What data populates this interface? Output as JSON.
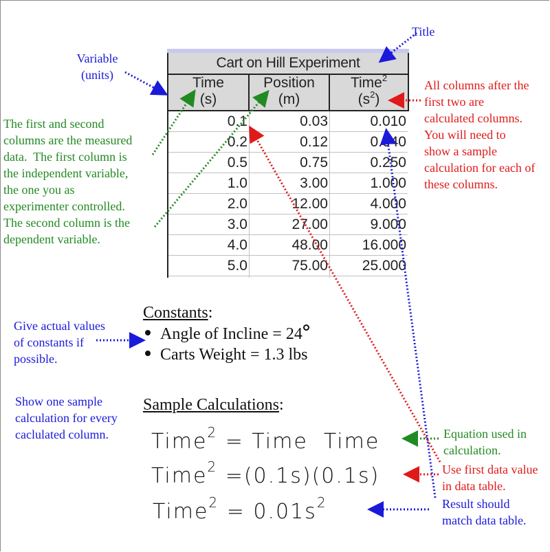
{
  "table": {
    "title": "Cart on Hill Experiment",
    "columns": [
      {
        "name": "Time",
        "unit": "(s)"
      },
      {
        "name": "Position",
        "unit": "(m)"
      },
      {
        "name": "Time",
        "name_sup": "2",
        "unit_base": "(s",
        "unit_sup": "2",
        "unit_close": ")"
      }
    ],
    "rows": [
      [
        "0.1",
        "0.03",
        "0.010"
      ],
      [
        "0.2",
        "0.12",
        "0.040"
      ],
      [
        "0.5",
        "0.75",
        "0.250"
      ],
      [
        "1.0",
        "3.00",
        "1.000"
      ],
      [
        "2.0",
        "12.00",
        "4.000"
      ],
      [
        "3.0",
        "27.00",
        "9.000"
      ],
      [
        "4.0",
        "48.00",
        "16.000"
      ],
      [
        "5.0",
        "75.00",
        "25.000"
      ]
    ]
  },
  "annotations": {
    "title_label": "Title",
    "variable_units": [
      "Variable",
      "(units)"
    ],
    "measured_columns": [
      "The first and second",
      "columns are the measured",
      "data.  The first column is",
      "the independent variable,",
      "the one you as",
      "experimenter controlled.",
      "The second column is the",
      "dependent variable."
    ],
    "calculated_columns": [
      "All columns after the",
      "first two are",
      "calculated columns.",
      "You will need to",
      "show a sample",
      "calculation for each of",
      "these columns."
    ],
    "constants_note": [
      "Give actual values",
      "of constants if",
      "possible."
    ],
    "sample_note": [
      "Show one sample",
      "calculation for every",
      "caclulated column."
    ],
    "equation_note": [
      "Equation used in",
      "calculation."
    ],
    "first_value_note": [
      "Use first data value",
      "in data table."
    ],
    "result_note": [
      "Result should",
      "match data table."
    ]
  },
  "constants": {
    "heading": "Constants",
    "heading_suffix": ":",
    "items": [
      {
        "text": "Angle of Incline = 24"
      },
      {
        "text": "Carts Weight = 1.3 lbs"
      }
    ]
  },
  "sample_calculations": {
    "heading": "Sample Calculations",
    "heading_suffix": ":",
    "lines": [
      {
        "lhs": "Time",
        "lhs_sup": "2",
        "rhs": "= Time  Time",
        "rhs_sup": ""
      },
      {
        "lhs": "Time",
        "lhs_sup": "2",
        "rhs": "=(0.1s)(0.1s)",
        "rhs_sup": ""
      },
      {
        "lhs": "Time",
        "lhs_sup": "2",
        "rhs": "= 0.01s",
        "rhs_sup": "2"
      }
    ]
  },
  "colors": {
    "blue": "#1a1adb",
    "green": "#228a22",
    "red": "#e01a1a",
    "header_fill": "#d9d9d9"
  }
}
